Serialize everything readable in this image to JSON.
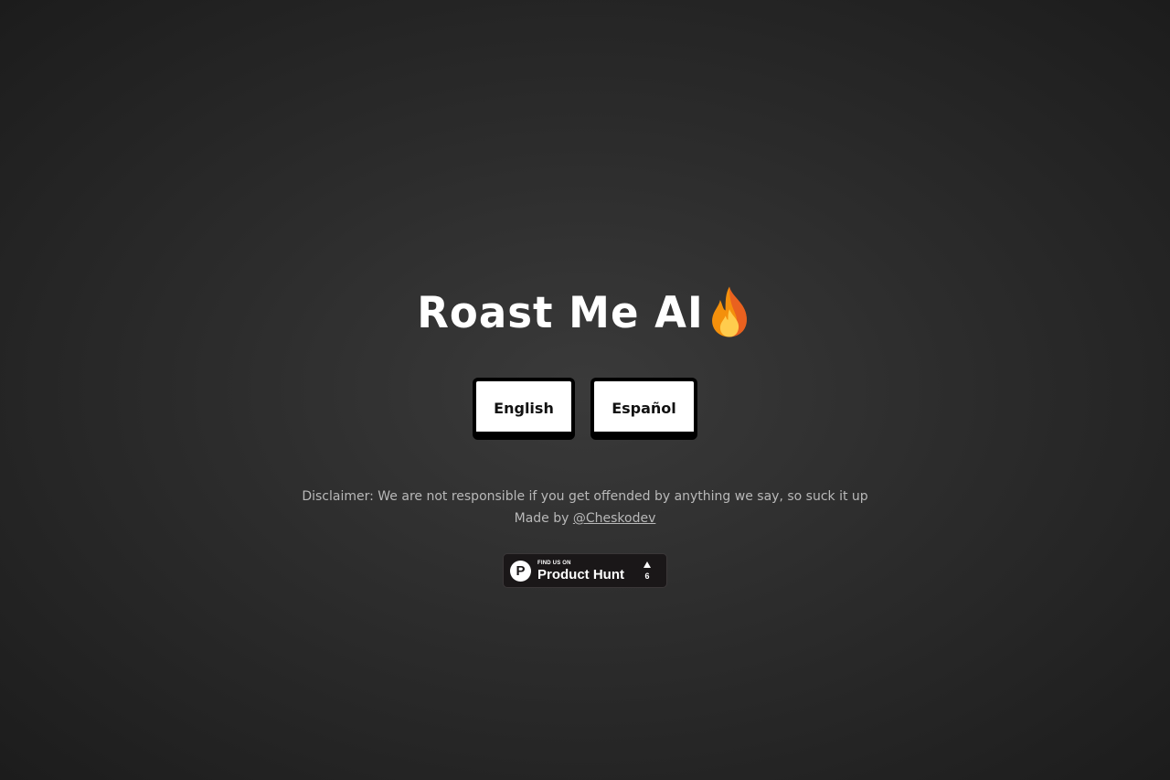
{
  "header": {
    "title": "Roast Me AI",
    "title_icon": "fire-icon"
  },
  "language_buttons": {
    "english_label": "English",
    "spanish_label": "Español"
  },
  "footer": {
    "disclaimer": "Disclaimer: We are not responsible if you get offended by anything we say, so suck it up",
    "made_by_prefix": "Made by ",
    "made_by_link": "@Cheskodev"
  },
  "product_hunt_badge": {
    "small_text": "FIND US ON",
    "big_text": "Product Hunt",
    "logo_letter": "P",
    "upvote_count": "6",
    "icon": "product-hunt-logo-icon"
  },
  "colors": {
    "background": "#2c2c2c",
    "button_background": "#ffffff",
    "button_border": "#000000",
    "muted_text": "#b9b9b9",
    "flame_orange": "#f4900c",
    "flame_red": "#e03a2f",
    "flame_yellow": "#ffcc4d"
  }
}
